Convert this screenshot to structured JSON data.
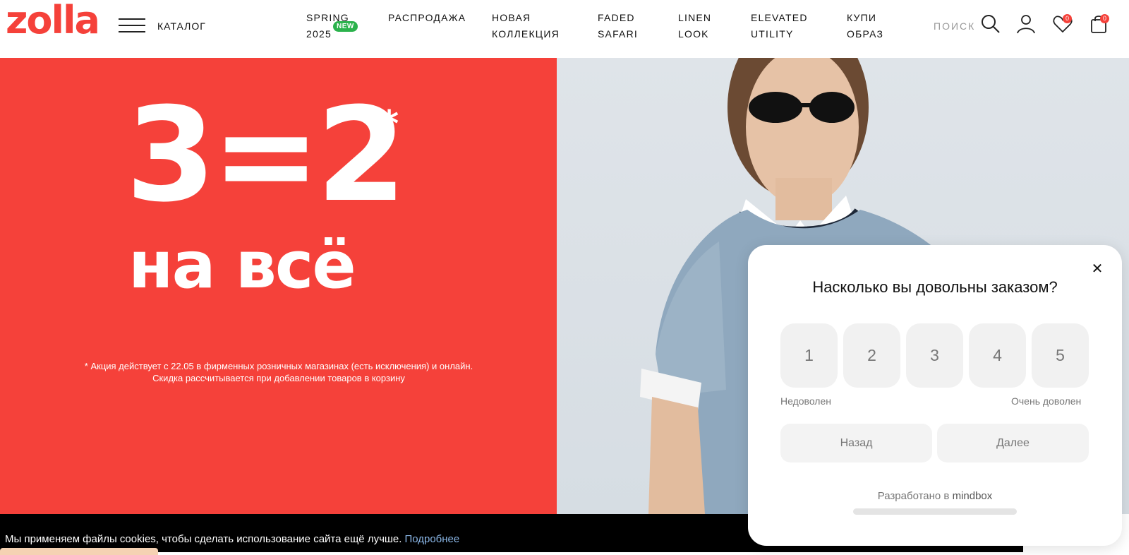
{
  "header": {
    "logo": "zolla",
    "catalog_label": "КАТАЛОГ",
    "nav": [
      {
        "line1": "SPRING",
        "line2": "2025"
      },
      {
        "line1": "РАСПРОДАЖА",
        "line2": ""
      },
      {
        "line1": "НОВАЯ",
        "line2": "КОЛЛЕКЦИЯ"
      },
      {
        "line1": "FADED",
        "line2": "SAFARI"
      },
      {
        "line1": "LINEN",
        "line2": "LOOK"
      },
      {
        "line1": "ELEVATED",
        "line2": "UTILITY"
      },
      {
        "line1": "КУПИ",
        "line2": "ОБРАЗ"
      }
    ],
    "new_badge": "NEW",
    "search_label": "ПОИСК",
    "wishlist_count": "0",
    "cart_count": "0"
  },
  "hero": {
    "promo_main": "3=2",
    "promo_star": "*",
    "promo_sub": "на всё",
    "note_line1": "* Акция действует с 22.05 в фирменных розничных магазинах (есть исключения) и онлайн.",
    "note_line2": "Скидка рассчитывается при добавлении товаров в корзину"
  },
  "cookie": {
    "text": "Мы применяем файлы cookies, чтобы сделать использование сайта ещё лучше.",
    "more": "Подробнее"
  },
  "survey": {
    "title": "Насколько вы довольны заказом?",
    "ratings": [
      "1",
      "2",
      "3",
      "4",
      "5"
    ],
    "low_label": "Недоволен",
    "high_label": "Очень доволен",
    "back": "Назад",
    "next": "Далее",
    "powered_prefix": "Разработано в",
    "powered_brand": "mindbox"
  },
  "colors": {
    "brand_red": "#f5413a",
    "new_badge": "#2bb24c",
    "link_blue": "#8ab6e6"
  }
}
